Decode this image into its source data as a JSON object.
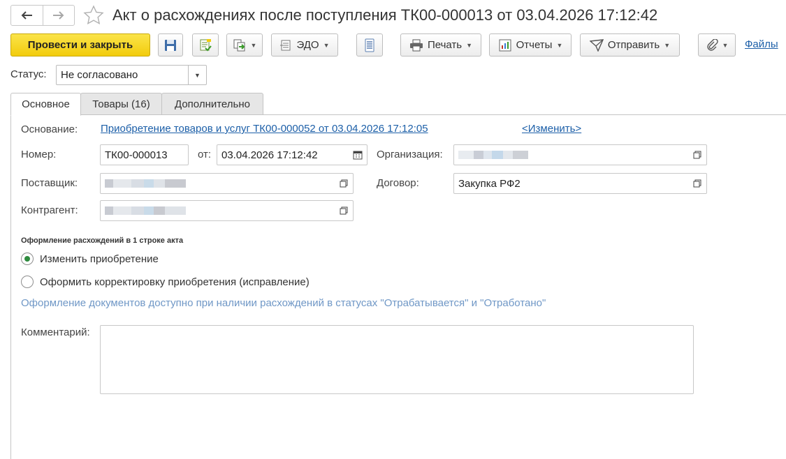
{
  "header": {
    "title": "Акт о расхождениях после поступления ТК00-000013 от 03.04.2026 17:12:42"
  },
  "toolbar": {
    "post_close": "Провести и закрыть",
    "edo": "ЭДО",
    "print": "Печать",
    "reports": "Отчеты",
    "send": "Отправить",
    "files": "Файлы"
  },
  "status": {
    "label": "Статус:",
    "value": "Не согласовано"
  },
  "tabs": [
    {
      "label": "Основное",
      "active": true
    },
    {
      "label": "Товары (16)",
      "active": false
    },
    {
      "label": "Дополнительно",
      "active": false
    }
  ],
  "form": {
    "basis_label": "Основание:",
    "basis_link": "Приобретение товаров и услуг ТК00-000052 от 03.04.2026 17:12:05",
    "change_link": "<Изменить>",
    "number_label": "Номер:",
    "number_value": "ТК00-000013",
    "date_label": "от:",
    "date_value": "03.04.2026 17:12:42",
    "org_label": "Организация:",
    "supplier_label": "Поставщик:",
    "contract_label": "Договор:",
    "contract_value": "Закупка РФ2",
    "counterparty_label": "Контрагент:",
    "section_title": "Оформление расхождений в 1 строке акта",
    "radio_change": "Изменить приобретение",
    "radio_correction": "Оформить корректировку приобретения (исправление)",
    "hint": "Оформление документов доступно при наличии расхождений в статусах \"Отрабатывается\" и \"Отработано\"",
    "comment_label": "Комментарий:",
    "comment_value": ""
  },
  "colors": {
    "primary_button": "#f5d320",
    "link": "#1c5fa8",
    "hint": "#6f97c6",
    "radio_selected": "#2e8b3e"
  },
  "icons": {
    "back": "arrow-left-icon",
    "forward": "arrow-right-icon",
    "favorite": "star-icon",
    "save": "floppy-disk-icon",
    "post": "post-document-icon",
    "create_based": "create-based-on-icon",
    "edo": "edo-icon",
    "structure": "document-structure-icon",
    "print": "printer-icon",
    "reports": "reports-icon",
    "send": "send-icon",
    "attach": "paperclip-icon",
    "calendar": "calendar-icon",
    "open": "open-form-icon"
  }
}
